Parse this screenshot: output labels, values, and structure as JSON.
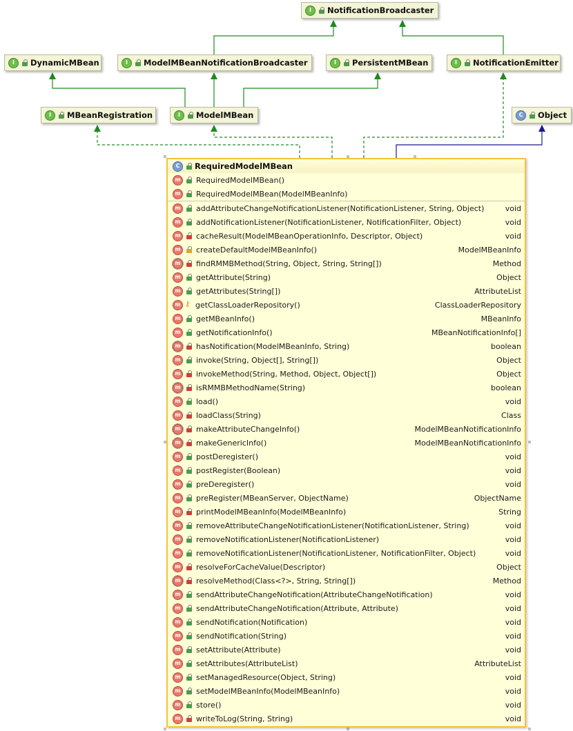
{
  "colors": {
    "inheritance_edge": "#1f8a1f",
    "class_edge": "#1a1a8a",
    "node_fill": "#f4f4d6",
    "main_fill": "#ffffd8",
    "main_border": "#f2c33b"
  },
  "nodes": {
    "notification_broadcaster": {
      "label": "NotificationBroadcaster",
      "kind": "interface"
    },
    "dynamic_mbean": {
      "label": "DynamicMBean",
      "kind": "interface"
    },
    "model_mbean_notification_broadcaster": {
      "label": "ModelMBeanNotificationBroadcaster",
      "kind": "interface"
    },
    "persistent_mbean": {
      "label": "PersistentMBean",
      "kind": "interface"
    },
    "notification_emitter": {
      "label": "NotificationEmitter",
      "kind": "interface"
    },
    "mbean_registration": {
      "label": "MBeanRegistration",
      "kind": "interface"
    },
    "model_mbean": {
      "label": "ModelMBean",
      "kind": "interface"
    },
    "object": {
      "label": "Object",
      "kind": "class"
    }
  },
  "main_class": {
    "name": "RequiredModelMBean",
    "kind": "class",
    "constructors": [
      {
        "sig": "RequiredModelMBean()",
        "vis": "public"
      },
      {
        "sig": "RequiredModelMBean(ModelMBeanInfo)",
        "vis": "public"
      }
    ],
    "methods": [
      {
        "sig": "addAttributeChangeNotificationListener(NotificationListener, String, Object)",
        "ret": "void",
        "vis": "public",
        "mod": ""
      },
      {
        "sig": "addNotificationListener(NotificationListener, NotificationFilter, Object)",
        "ret": "void",
        "vis": "public",
        "mod": ""
      },
      {
        "sig": "cacheResult(ModelMBeanOperationInfo, Descriptor, Object)",
        "ret": "void",
        "vis": "private",
        "mod": ""
      },
      {
        "sig": "createDefaultModelMBeanInfo()",
        "ret": "ModelMBeanInfo",
        "vis": "protected",
        "mod": ""
      },
      {
        "sig": "findRMMBMethod(String, Object, String, String[])",
        "ret": "Method",
        "vis": "private",
        "mod": "static"
      },
      {
        "sig": "getAttribute(String)",
        "ret": "Object",
        "vis": "public",
        "mod": ""
      },
      {
        "sig": "getAttributes(String[])",
        "ret": "AttributeList",
        "vis": "public",
        "mod": ""
      },
      {
        "sig": "getClassLoaderRepository()",
        "ret": "ClassLoaderRepository",
        "vis": "package",
        "mod": "key"
      },
      {
        "sig": "getMBeanInfo()",
        "ret": "MBeanInfo",
        "vis": "public",
        "mod": ""
      },
      {
        "sig": "getNotificationInfo()",
        "ret": "MBeanNotificationInfo[]",
        "vis": "public",
        "mod": ""
      },
      {
        "sig": "hasNotification(ModelMBeanInfo, String)",
        "ret": "boolean",
        "vis": "private",
        "mod": "static"
      },
      {
        "sig": "invoke(String, Object[], String[])",
        "ret": "Object",
        "vis": "public",
        "mod": ""
      },
      {
        "sig": "invokeMethod(String, Method, Object, Object[])",
        "ret": "Object",
        "vis": "private",
        "mod": ""
      },
      {
        "sig": "isRMMBMethodName(String)",
        "ret": "boolean",
        "vis": "private",
        "mod": "static"
      },
      {
        "sig": "load()",
        "ret": "void",
        "vis": "public",
        "mod": ""
      },
      {
        "sig": "loadClass(String)",
        "ret": "Class",
        "vis": "private",
        "mod": ""
      },
      {
        "sig": "makeAttributeChangeInfo()",
        "ret": "ModelMBeanNotificationInfo",
        "vis": "private",
        "mod": "static"
      },
      {
        "sig": "makeGenericInfo()",
        "ret": "ModelMBeanNotificationInfo",
        "vis": "private",
        "mod": "static"
      },
      {
        "sig": "postDeregister()",
        "ret": "void",
        "vis": "public",
        "mod": ""
      },
      {
        "sig": "postRegister(Boolean)",
        "ret": "void",
        "vis": "public",
        "mod": ""
      },
      {
        "sig": "preDeregister()",
        "ret": "void",
        "vis": "public",
        "mod": ""
      },
      {
        "sig": "preRegister(MBeanServer, ObjectName)",
        "ret": "ObjectName",
        "vis": "public",
        "mod": ""
      },
      {
        "sig": "printModelMBeanInfo(ModelMBeanInfo)",
        "ret": "String",
        "vis": "private",
        "mod": ""
      },
      {
        "sig": "removeAttributeChangeNotificationListener(NotificationListener, String)",
        "ret": "void",
        "vis": "public",
        "mod": ""
      },
      {
        "sig": "removeNotificationListener(NotificationListener)",
        "ret": "void",
        "vis": "public",
        "mod": ""
      },
      {
        "sig": "removeNotificationListener(NotificationListener, NotificationFilter, Object)",
        "ret": "void",
        "vis": "public",
        "mod": ""
      },
      {
        "sig": "resolveForCacheValue(Descriptor)",
        "ret": "Object",
        "vis": "private",
        "mod": ""
      },
      {
        "sig": "resolveMethod(Class<?>, String, String[])",
        "ret": "Method",
        "vis": "private",
        "mod": "static"
      },
      {
        "sig": "sendAttributeChangeNotification(AttributeChangeNotification)",
        "ret": "void",
        "vis": "public",
        "mod": ""
      },
      {
        "sig": "sendAttributeChangeNotification(Attribute, Attribute)",
        "ret": "void",
        "vis": "public",
        "mod": ""
      },
      {
        "sig": "sendNotification(Notification)",
        "ret": "void",
        "vis": "public",
        "mod": ""
      },
      {
        "sig": "sendNotification(String)",
        "ret": "void",
        "vis": "public",
        "mod": ""
      },
      {
        "sig": "setAttribute(Attribute)",
        "ret": "void",
        "vis": "public",
        "mod": ""
      },
      {
        "sig": "setAttributes(AttributeList)",
        "ret": "AttributeList",
        "vis": "public",
        "mod": ""
      },
      {
        "sig": "setManagedResource(Object, String)",
        "ret": "void",
        "vis": "public",
        "mod": ""
      },
      {
        "sig": "setModelMBeanInfo(ModelMBeanInfo)",
        "ret": "void",
        "vis": "public",
        "mod": ""
      },
      {
        "sig": "store()",
        "ret": "void",
        "vis": "public",
        "mod": ""
      },
      {
        "sig": "writeToLog(String, String)",
        "ret": "void",
        "vis": "private",
        "mod": ""
      }
    ]
  }
}
